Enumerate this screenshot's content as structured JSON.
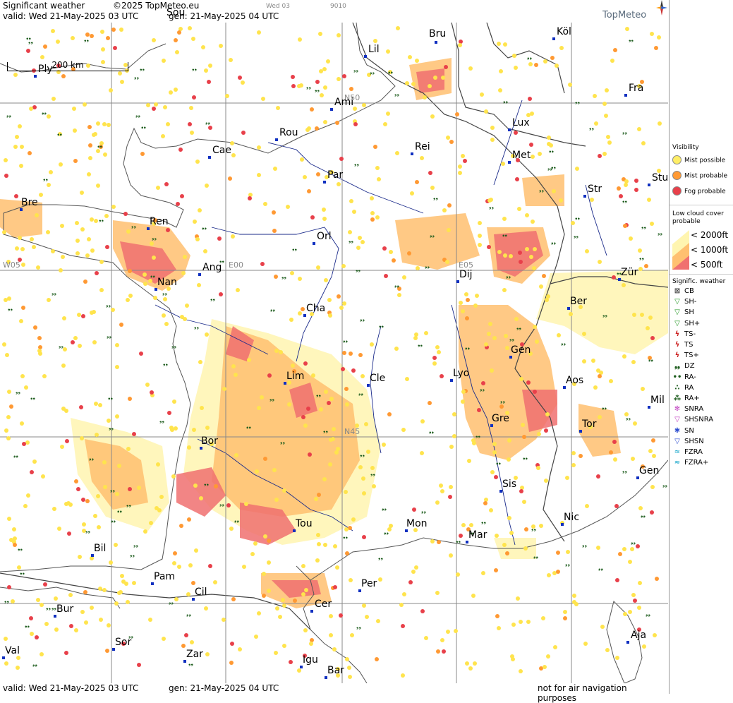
{
  "header": {
    "title": "Significant weather",
    "copyright": "©2025 TopMeteo.eu",
    "valid": "valid:  Wed  21-May-2025  03 UTC",
    "gen": "gen: 21-May-2025 04 UTC",
    "small_a": "Wed 03",
    "small_b": "9010",
    "logo": "TopMeteo"
  },
  "footer": {
    "valid": "valid:  Wed  21-May-2025  03 UTC",
    "gen": "gen: 21-May-2025 04 UTC",
    "disclaimer": "not for air navigation purposes"
  },
  "scale_label": "200 km",
  "grid_labels": {
    "n50": "N50",
    "n45": "N45",
    "w05": "W05",
    "e00": "E00",
    "e05": "E05"
  },
  "cities": [
    {
      "name": "Sou"
    },
    {
      "name": "Bru"
    },
    {
      "name": "Köl"
    },
    {
      "name": "Lil"
    },
    {
      "name": "Ply"
    },
    {
      "name": "Ami"
    },
    {
      "name": "Fra"
    },
    {
      "name": "Lux"
    },
    {
      "name": "Rou"
    },
    {
      "name": "Cae"
    },
    {
      "name": "Rei"
    },
    {
      "name": "Met"
    },
    {
      "name": "Par"
    },
    {
      "name": "Stu"
    },
    {
      "name": "Str"
    },
    {
      "name": "Bre"
    },
    {
      "name": "Ren"
    },
    {
      "name": "Orl"
    },
    {
      "name": "Ang"
    },
    {
      "name": "Dij"
    },
    {
      "name": "Zür"
    },
    {
      "name": "Nan"
    },
    {
      "name": "Cha"
    },
    {
      "name": "Ber"
    },
    {
      "name": "Gen"
    },
    {
      "name": "Lim"
    },
    {
      "name": "Cle"
    },
    {
      "name": "Lyo"
    },
    {
      "name": "Aos"
    },
    {
      "name": "Mil"
    },
    {
      "name": "Gre"
    },
    {
      "name": "Tor"
    },
    {
      "name": "Bor"
    },
    {
      "name": "Gen"
    },
    {
      "name": "Sis"
    },
    {
      "name": "Tou"
    },
    {
      "name": "Mon"
    },
    {
      "name": "Mar"
    },
    {
      "name": "Nic"
    },
    {
      "name": "Bil"
    },
    {
      "name": "Pam"
    },
    {
      "name": "Cil"
    },
    {
      "name": "Per"
    },
    {
      "name": "Bur"
    },
    {
      "name": "Cer"
    },
    {
      "name": "Sor"
    },
    {
      "name": "Val"
    },
    {
      "name": "Zar"
    },
    {
      "name": "Aja"
    },
    {
      "name": "Igu"
    },
    {
      "name": "Bar"
    }
  ],
  "legend": {
    "visibility_title": "Visibility",
    "visibility": [
      {
        "label": "Mist possible",
        "color": "#ffee66"
      },
      {
        "label": "Mist probable",
        "color": "#ff9933"
      },
      {
        "label": "Fog probable",
        "color": "#e8404a"
      }
    ],
    "lowcloud_title_1": "Low cloud cover",
    "lowcloud_title_2": "probable",
    "lowcloud": [
      {
        "label": "< 2000ft",
        "color": "#fff5b0"
      },
      {
        "label": "< 1000ft",
        "color": "#ffc070"
      },
      {
        "label": "<  500ft",
        "color": "#f07070"
      }
    ],
    "sigwx_title": "Signific. weather",
    "sigwx": [
      {
        "label": "CB",
        "icon": "cb-icon",
        "symbol": "⊠",
        "color": "#444"
      },
      {
        "label": "SH-",
        "icon": "shower-light-icon",
        "symbol": "▽",
        "color": "#2a9a2a"
      },
      {
        "label": "SH",
        "icon": "shower-icon",
        "symbol": "▽",
        "color": "#2a9a2a"
      },
      {
        "label": "SH+",
        "icon": "shower-heavy-icon",
        "symbol": "▽",
        "color": "#2a9a2a"
      },
      {
        "label": "TS-",
        "icon": "thunderstorm-light-icon",
        "symbol": "ϟ",
        "color": "#cc2020"
      },
      {
        "label": "TS",
        "icon": "thunderstorm-icon",
        "symbol": "ϟ",
        "color": "#cc2020"
      },
      {
        "label": "TS+",
        "icon": "thunderstorm-heavy-icon",
        "symbol": "ϟ",
        "color": "#cc2020"
      },
      {
        "label": "DZ",
        "icon": "drizzle-icon",
        "symbol": "❟❟",
        "color": "#1a5a1a"
      },
      {
        "label": "RA-",
        "icon": "rain-light-icon",
        "symbol": "••",
        "color": "#1a5a1a"
      },
      {
        "label": "RA",
        "icon": "rain-icon",
        "symbol": "∴",
        "color": "#1a5a1a"
      },
      {
        "label": "RA+",
        "icon": "rain-heavy-icon",
        "symbol": "⁂",
        "color": "#1a5a1a"
      },
      {
        "label": "SNRA",
        "icon": "snow-rain-icon",
        "symbol": "✻",
        "color": "#c040c0"
      },
      {
        "label": "SHSNRA",
        "icon": "snow-rain-shower-icon",
        "symbol": "▽",
        "color": "#c040c0"
      },
      {
        "label": "SN",
        "icon": "snow-icon",
        "symbol": "✱",
        "color": "#3050d0"
      },
      {
        "label": "SHSN",
        "icon": "snow-shower-icon",
        "symbol": "▽",
        "color": "#3050d0"
      },
      {
        "label": "FZRA",
        "icon": "freezing-rain-icon",
        "symbol": "≈",
        "color": "#30b0d0"
      },
      {
        "label": "FZRA+",
        "icon": "freezing-rain-heavy-icon",
        "symbol": "≈",
        "color": "#30b0d0"
      }
    ]
  }
}
